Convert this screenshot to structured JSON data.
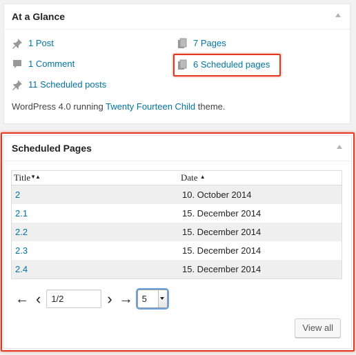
{
  "glance": {
    "title": "At a Glance",
    "items": {
      "posts": "1 Post",
      "comments": "1 Comment",
      "scheduled_posts": "11 Scheduled posts",
      "pages": "7 Pages",
      "scheduled_pages": "6 Scheduled pages"
    },
    "note_prefix": "WordPress 4.0 running ",
    "note_theme": "Twenty Fourteen Child",
    "note_suffix": " theme.",
    "icons": {
      "posts": "pushpin-icon",
      "comments": "comment-icon",
      "scheduled_posts": "pushpin-icon",
      "pages": "pages-icon",
      "scheduled_pages": "pages-icon"
    }
  },
  "scheduled": {
    "title": "Scheduled Pages",
    "columns": {
      "title": "Title",
      "date": "Date"
    },
    "rows": [
      {
        "title": "2",
        "date": "10. October 2014"
      },
      {
        "title": "2.1",
        "date": "15. December 2014"
      },
      {
        "title": "2.2",
        "date": "15. December 2014"
      },
      {
        "title": "2.3",
        "date": "15. December 2014"
      },
      {
        "title": "2.4",
        "date": "15. December 2014"
      }
    ],
    "pager": {
      "first": "←",
      "prev": "‹",
      "page_value": "1/2",
      "next": "›",
      "last": "→",
      "per_page": "5"
    },
    "view_all": "View all"
  },
  "colors": {
    "link": "#0074a2",
    "highlight": "#e8371f",
    "row_alt": "#efefef"
  }
}
